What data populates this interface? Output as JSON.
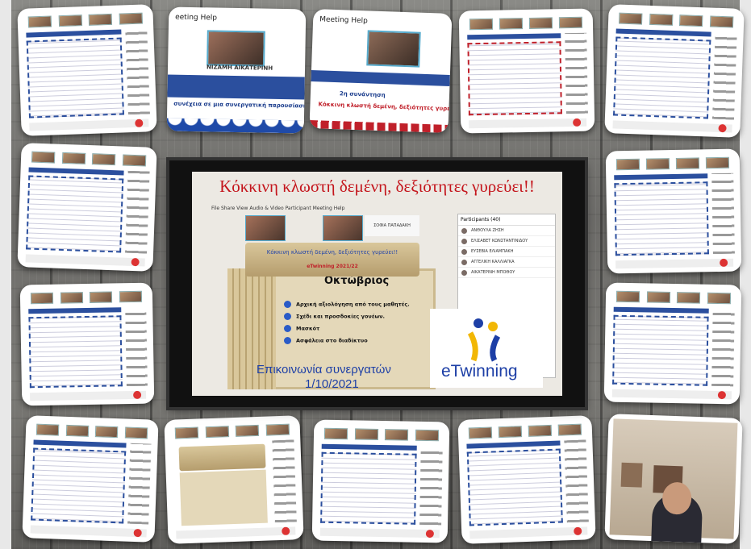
{
  "collage": {
    "main_title": "Κόκκινη κλωστή δεμένη, δεξιότητες γυρεύει!!",
    "subtitle_line1": "Επικοινωνία συνεργατών",
    "subtitle_line2": "1/10/2021",
    "logo_text": "eTwinning",
    "month": "Οκτώβριος",
    "year_label": "eTwinning 2021/22",
    "scroll_title": "Κόκκινη κλωστή δεμένη, δεξιότητες γυρεύει!!",
    "list_items": [
      "Αρχική αξιολόγηση από τους μαθητές.",
      "Σχέδι και προσδοκίες γονέων.",
      "Μασκότ",
      "Ασφάλεια στο διαδίκτυο"
    ],
    "menu_bar": "File  Share  View  Audio & Video  Participant  Meeting  Help",
    "participants_header": "Participants (40)",
    "participants": [
      "ΑΝΘΟΥΛΑ ΖΗΣΗ",
      "ΕΛΙΣΑΒΕΤ ΚΩΝΣΤΑΝΤΙΝΙΔΟΥ",
      "ΕΥΣΕΒΙΑ ΕΛΙΑΜΠΑΚΗ",
      "ΑΓΓΕΛΙΚΗ ΚΑΛΛΙΑΓΚΑ",
      "ΑΙΚΑΤΕΡΙΝΗ ΜΠΟΘΟΥ"
    ],
    "meeting_name_right": "ΣΟΦΙΑ ΠΑΠΑΔΑΚΗ",
    "thumb2_menu": "eeting  Help",
    "thumb2_name": "ΝΙΖΑΜΗ ΑΙΚΑΤΕΡΙΝΗ",
    "thumb2_text": "συνέχεια σε μια συνεργατική παρουσίαση, τη carrie",
    "thumb3_menu": "Meeting  Help",
    "thumb3_meeting": "2η συνάντηση",
    "thumb3_title": "Κόκκινη κλωστή δεμένη, δεξιότητες γυρεύει!!"
  }
}
